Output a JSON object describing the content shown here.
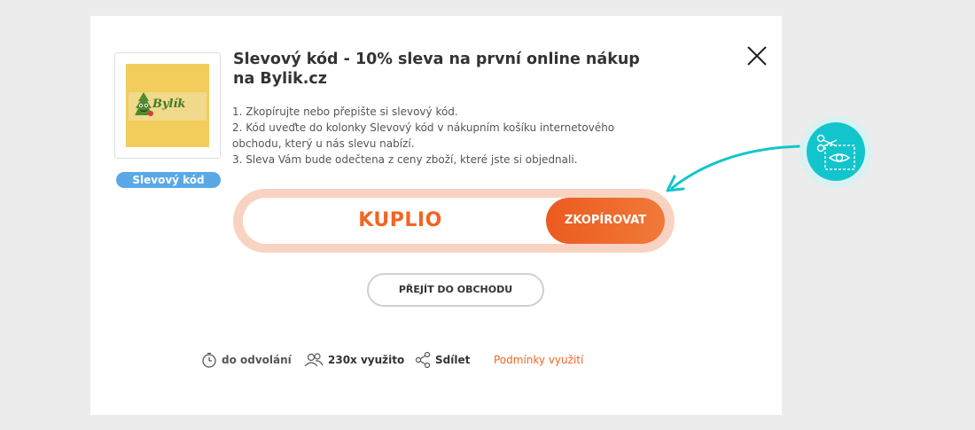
{
  "brand": {
    "name": "Bylík",
    "badge": "Slevový kód"
  },
  "title": "Slevový kód - 10% sleva na první online nákup na Bylik.cz",
  "steps": [
    "1. Zkopírujte nebo přepište si slevový kód.",
    "2. Kód uveďte do kolonky Slevový kód v nákupním košíku internetového obchodu, který u nás slevu nabízí.",
    "3. Sleva Vám bude odečtena z ceny zboží, které jste si objednali."
  ],
  "coupon": {
    "code": "KUPLIO",
    "copy_label": "ZKOPÍROVAT"
  },
  "shop_button": "PŘEJÍT DO OBCHODU",
  "meta": {
    "validity": "do odvolání",
    "usage": "230x využito",
    "share": "Sdílet",
    "terms": "Podmínky využití"
  },
  "icons": {
    "close": "close-icon",
    "timer": "stopwatch-icon",
    "users": "users-icon",
    "share": "share-icon",
    "tip": "scissors-eye-icon"
  },
  "colors": {
    "accent": "#f26522",
    "badge": "#5aa9e6",
    "tip": "#12c5cc",
    "code_ring": "#f9d3c2"
  }
}
